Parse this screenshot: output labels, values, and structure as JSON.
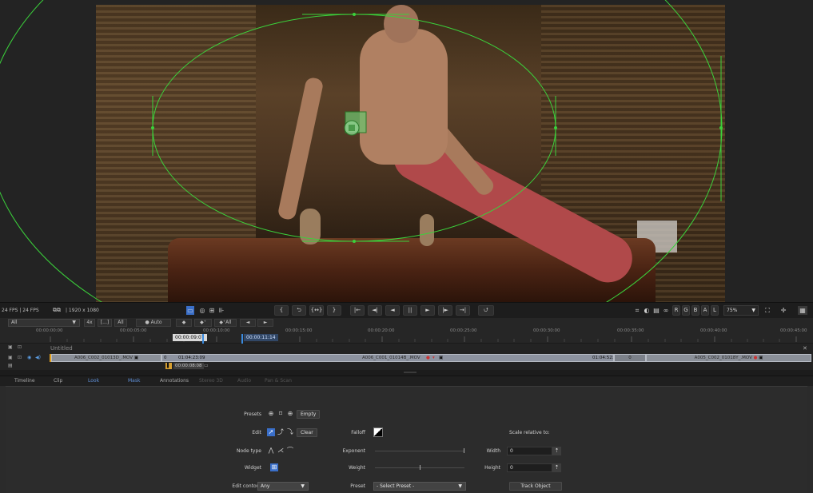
{
  "viewer": {
    "fps_label": "24 FPS | 24 FPS",
    "resolution": "| 1920 x 1080",
    "zoom": "75%"
  },
  "transport": {
    "mark_in": "{",
    "loop": "⮌",
    "mark_inout": "{↔}",
    "mark_out": "}",
    "go_start": "|←",
    "step_back": "◄|",
    "play_rev": "◄",
    "pause": "||",
    "play": "►",
    "step_fwd": "|►",
    "go_end": "→|",
    "loop_toggle": "⮍",
    "channel_r": "R",
    "channel_g": "G",
    "channel_b": "B",
    "channel_a": "A",
    "channel_l": "L"
  },
  "keyframes": {
    "filter": "All",
    "btn_n": "4x",
    "btn_range": "[...]",
    "btn_all": "All",
    "auto": "● Auto",
    "add": "◆",
    "add_plus": "◆⁺",
    "add_all": "◆⁺All",
    "prev": "◄",
    "next": "►"
  },
  "ruler": {
    "ticks": [
      "00:00:00:00",
      "00:00:05:00",
      "00:00:10:00",
      "00:00:15:00",
      "00:00:20:00",
      "00:00:25:00",
      "00:00:30:00",
      "00:00:35:00",
      "00:00:40:00",
      "00:00:45:00"
    ],
    "current_tc": "00:00:09:07",
    "duration_tc": "00:00:11:14"
  },
  "timeline": {
    "sequence_name": "Untitled",
    "clips": [
      {
        "name": "A006_C002_01013D_.MOV"
      },
      {
        "name": "A006_C001_01014B_.MOV"
      },
      {
        "name": "A005_C002_01018Y_.MOV"
      }
    ],
    "clip_in_tc": "01:04:23:09",
    "clip_offset": "0",
    "clip_length_tc": "00:00:08:08",
    "clip_out_tc": "01:04:52:14",
    "clip_count": "0"
  },
  "tabs": [
    "Timeline",
    "Clip",
    "Look",
    "Mask",
    "Annotations",
    "Stereo 3D",
    "Audio",
    "Pan & Scan"
  ],
  "mask": {
    "presets_label": "Presets",
    "empty_btn": "Empty",
    "edit_label": "Edit",
    "clear_btn": "Clear",
    "node_type_label": "Node type",
    "widget_label": "Widget",
    "edit_contour_label": "Edit contour",
    "edit_contour_value": "Any",
    "falloff_label": "Falloff",
    "exponent_label": "Exponent",
    "weight_label": "Weight",
    "preset_label": "Preset",
    "preset_value": "- Select Preset -",
    "scale_label": "Scale relative to:",
    "width_label": "Width",
    "width_value": "0",
    "height_label": "Height",
    "height_value": "0",
    "track_btn": "Track Object"
  }
}
